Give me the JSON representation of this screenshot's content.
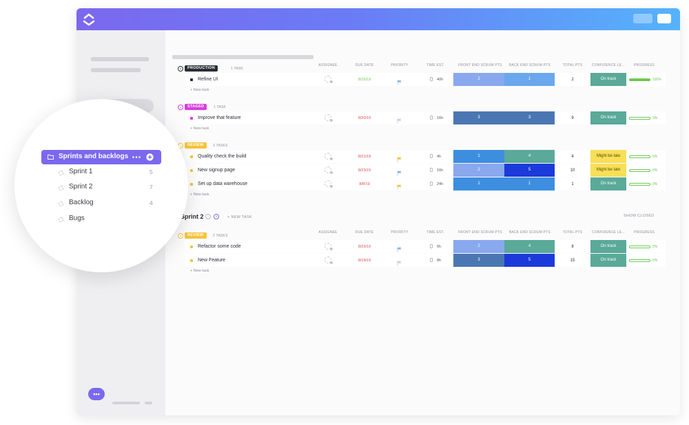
{
  "colors": {
    "accent": "#7b68ee",
    "production": "#292d34",
    "staged": "#d83fdf",
    "review": "#f5c43b",
    "on_track": "#5aa999",
    "might_be_late": "#f7df58",
    "progress": "#6bc950"
  },
  "columns": [
    "ASSIGNEE",
    "DUE DATE",
    "PRIORITY",
    "TIME EST.",
    "FRONT END SCRUM PTS",
    "BACK END SCRUM PTS",
    "TOTAL PTS",
    "CONFIDENCE LE...",
    "PROGRESS"
  ],
  "groups": [
    {
      "status": "PRODUCTION",
      "count": "1 TASK",
      "color": "#292d34",
      "new_task": "+ New task",
      "tasks": [
        {
          "name": "Refine UI",
          "due": "8/15/19",
          "due_color": "#6bc950",
          "priority_color": "#87b9e8",
          "est": "40h",
          "fe": "2",
          "fe_color": "#89a8ee",
          "be": "1",
          "be_color": "#6aa7ed",
          "total": "2",
          "confidence": "On track",
          "conf_color": "#5aa999",
          "progress": 1.0,
          "progress_label": "100%"
        }
      ]
    },
    {
      "status": "STAGED",
      "count": "1 TASK",
      "color": "#d83fdf",
      "new_task": "+ New task",
      "tasks": [
        {
          "name": "Improve that feature",
          "due": "8/20/19",
          "due_color": "#e5484d",
          "priority_color": "#c8d2e6",
          "est": "16h",
          "fe": "3",
          "fe_color": "#4a77b2",
          "be": "3",
          "be_color": "#4a77b2",
          "total": "9",
          "confidence": "On track",
          "conf_color": "#5aa999",
          "progress": 0,
          "progress_label": "0%"
        }
      ]
    },
    {
      "status": "REVIEW",
      "count": "3 TASKS",
      "color": "#f5c43b",
      "new_task": "+ New task",
      "tasks": [
        {
          "name": "Quality check the build",
          "due": "8/21/19",
          "due_color": "#e5484d",
          "priority_color": "#f5c43b",
          "est": "4h",
          "fe": "1",
          "fe_color": "#3e8ee0",
          "be": "4",
          "be_color": "#5aa999",
          "total": "4",
          "confidence": "Might be late",
          "conf_color": "#f7df58",
          "progress": 0,
          "progress_label": "0%"
        },
        {
          "name": "New signup page",
          "due": "8/23/19",
          "due_color": "#e5484d",
          "priority_color": "#87b9e8",
          "est": "16h",
          "fe": "2",
          "fe_color": "#89a8ee",
          "be": "5",
          "be_color": "#1c3ad9",
          "total": "10",
          "confidence": "Might be late",
          "conf_color": "#f7df58",
          "progress": 0,
          "progress_label": "0%"
        },
        {
          "name": "Set up data warehouse",
          "due": "8/8/19",
          "due_color": "#e5484d",
          "priority_color": "#f5c43b",
          "est": "24h",
          "fe": "1",
          "fe_color": "#3e8ee0",
          "be": "1",
          "be_color": "#3e8ee0",
          "total": "1",
          "confidence": "On track",
          "conf_color": "#5aa999",
          "progress": 0,
          "progress_label": "0%"
        }
      ]
    }
  ],
  "sprint2": {
    "title": "Sprint 2",
    "new_task": "+ NEW TASK",
    "show_closed": "SHOW CLOSED",
    "group": {
      "status": "REVIEW",
      "count": "2 TASKS",
      "color": "#f5c43b",
      "new_task": "+ New task",
      "tasks": [
        {
          "name": "Refactor some code",
          "due": "8/23/19",
          "due_color": "#e5484d",
          "priority_color": "#87b9e8",
          "est": "5h",
          "fe": "2",
          "fe_color": "#89a8ee",
          "be": "4",
          "be_color": "#5aa999",
          "total": "8",
          "confidence": "On track",
          "conf_color": "#5aa999",
          "progress": 0,
          "progress_label": "0%"
        },
        {
          "name": "New Feature",
          "due": "8/19/19",
          "due_color": "#e5484d",
          "priority_color": "#c8d2e6",
          "est": "8h",
          "fe": "3",
          "fe_color": "#4a77b2",
          "be": "5",
          "be_color": "#1c3ad9",
          "total": "15",
          "confidence": "On track",
          "conf_color": "#5aa999",
          "progress": 0,
          "progress_label": "0%"
        }
      ]
    }
  },
  "zoom": {
    "active": "Sprints and backlogs",
    "items": [
      {
        "label": "Sprint 1",
        "count": "5"
      },
      {
        "label": "Sprint 2",
        "count": "7"
      },
      {
        "label": "Backlog",
        "count": "4"
      },
      {
        "label": "Bugs",
        "count": ""
      }
    ]
  },
  "icons": {
    "logo": "clickup-logo-icon",
    "chat": "chat-icon",
    "folder": "folder-icon",
    "more": "more-dots-icon",
    "add": "add-circle-icon",
    "flag": "flag-icon",
    "hourglass": "hourglass-icon"
  }
}
